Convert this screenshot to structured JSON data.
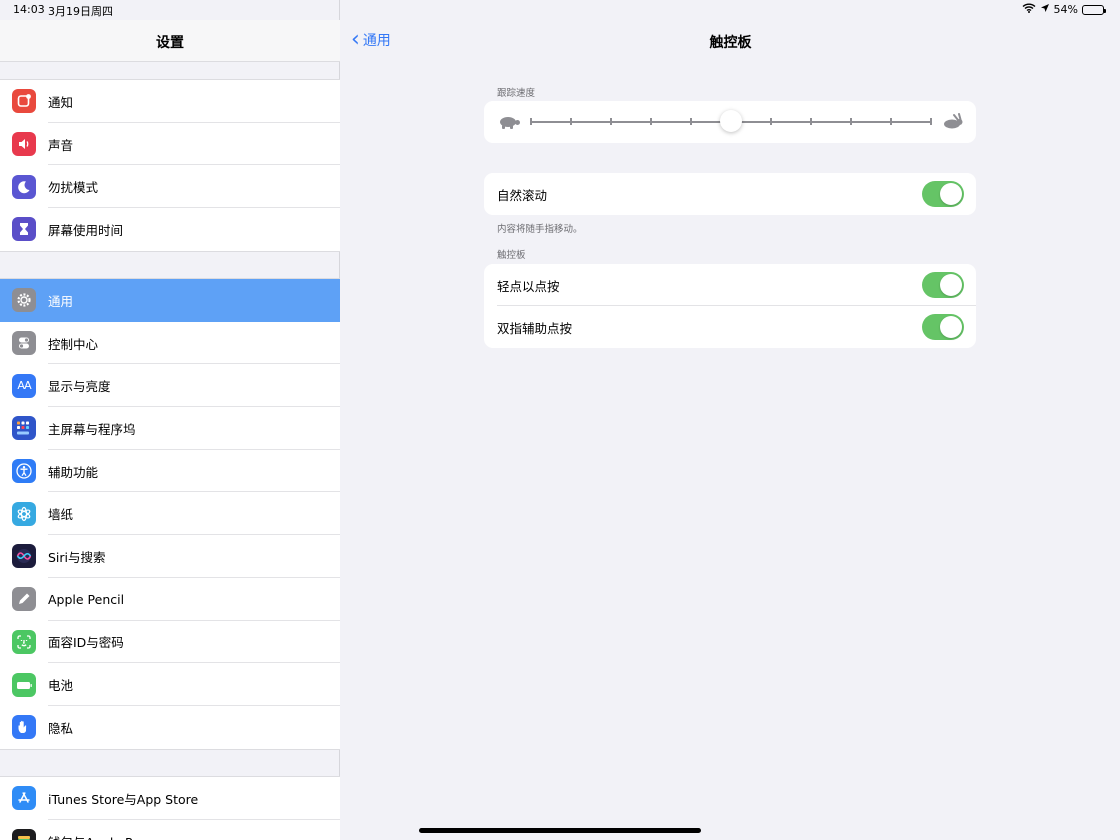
{
  "status_bar": {
    "time": "14:03",
    "date": "3月19日周四",
    "battery_percent": "54%",
    "battery_level": 0.54
  },
  "sidebar": {
    "title": "设置",
    "groups": [
      {
        "items": [
          {
            "label": "通知",
            "icon": "notification-icon",
            "color": "#e9493d"
          },
          {
            "label": "声音",
            "icon": "speaker-icon",
            "color": "#e8394d"
          },
          {
            "label": "勿扰模式",
            "icon": "moon-icon",
            "color": "#5a56d2"
          },
          {
            "label": "屏幕使用时间",
            "icon": "hourglass-icon",
            "color": "#5a4ec8"
          }
        ]
      },
      {
        "items": [
          {
            "label": "通用",
            "icon": "gear-icon",
            "color": "#8e8e93",
            "selected": true
          },
          {
            "label": "控制中心",
            "icon": "switches-icon",
            "color": "#8e8e93"
          },
          {
            "label": "显示与亮度",
            "icon": "text-size-icon",
            "color": "#3478f6"
          },
          {
            "label": "主屏幕与程序坞",
            "icon": "app-grid-icon",
            "color": "#2f55c9"
          },
          {
            "label": "辅助功能",
            "icon": "accessibility-icon",
            "color": "#2f7cf6"
          },
          {
            "label": "墙纸",
            "icon": "flower-icon",
            "color": "#36a9e1"
          },
          {
            "label": "Siri与搜索",
            "icon": "siri-icon",
            "color": "#1c1c3c"
          },
          {
            "label": "Apple Pencil",
            "icon": "pencil-icon",
            "color": "#8e8e93"
          },
          {
            "label": "面容ID与密码",
            "icon": "face-id-icon",
            "color": "#4cc763"
          },
          {
            "label": "电池",
            "icon": "battery-icon",
            "color": "#4cc763"
          },
          {
            "label": "隐私",
            "icon": "hand-icon",
            "color": "#3478f6"
          }
        ]
      },
      {
        "items": [
          {
            "label": "iTunes Store与App Store",
            "icon": "app-store-icon",
            "color": "#2f8cf6"
          },
          {
            "label": "钱包与Apple Pay",
            "icon": "wallet-icon",
            "color": "#1c1c1e"
          }
        ]
      }
    ]
  },
  "main": {
    "back_label": "通用",
    "title": "触控板",
    "tracking_speed": {
      "label": "跟踪速度",
      "value": 0.5,
      "steps": 10
    },
    "natural_scroll": {
      "label": "自然滚动",
      "on": true,
      "footer": "内容将随手指移动。"
    },
    "trackpad_section": {
      "label": "触控板",
      "rows": [
        {
          "label": "轻点以点按",
          "on": true
        },
        {
          "label": "双指辅助点按",
          "on": true
        }
      ]
    }
  },
  "colors": {
    "accent": "#3478f6",
    "selected_row": "#5ea1f6",
    "toggle_on": "#65c466"
  }
}
